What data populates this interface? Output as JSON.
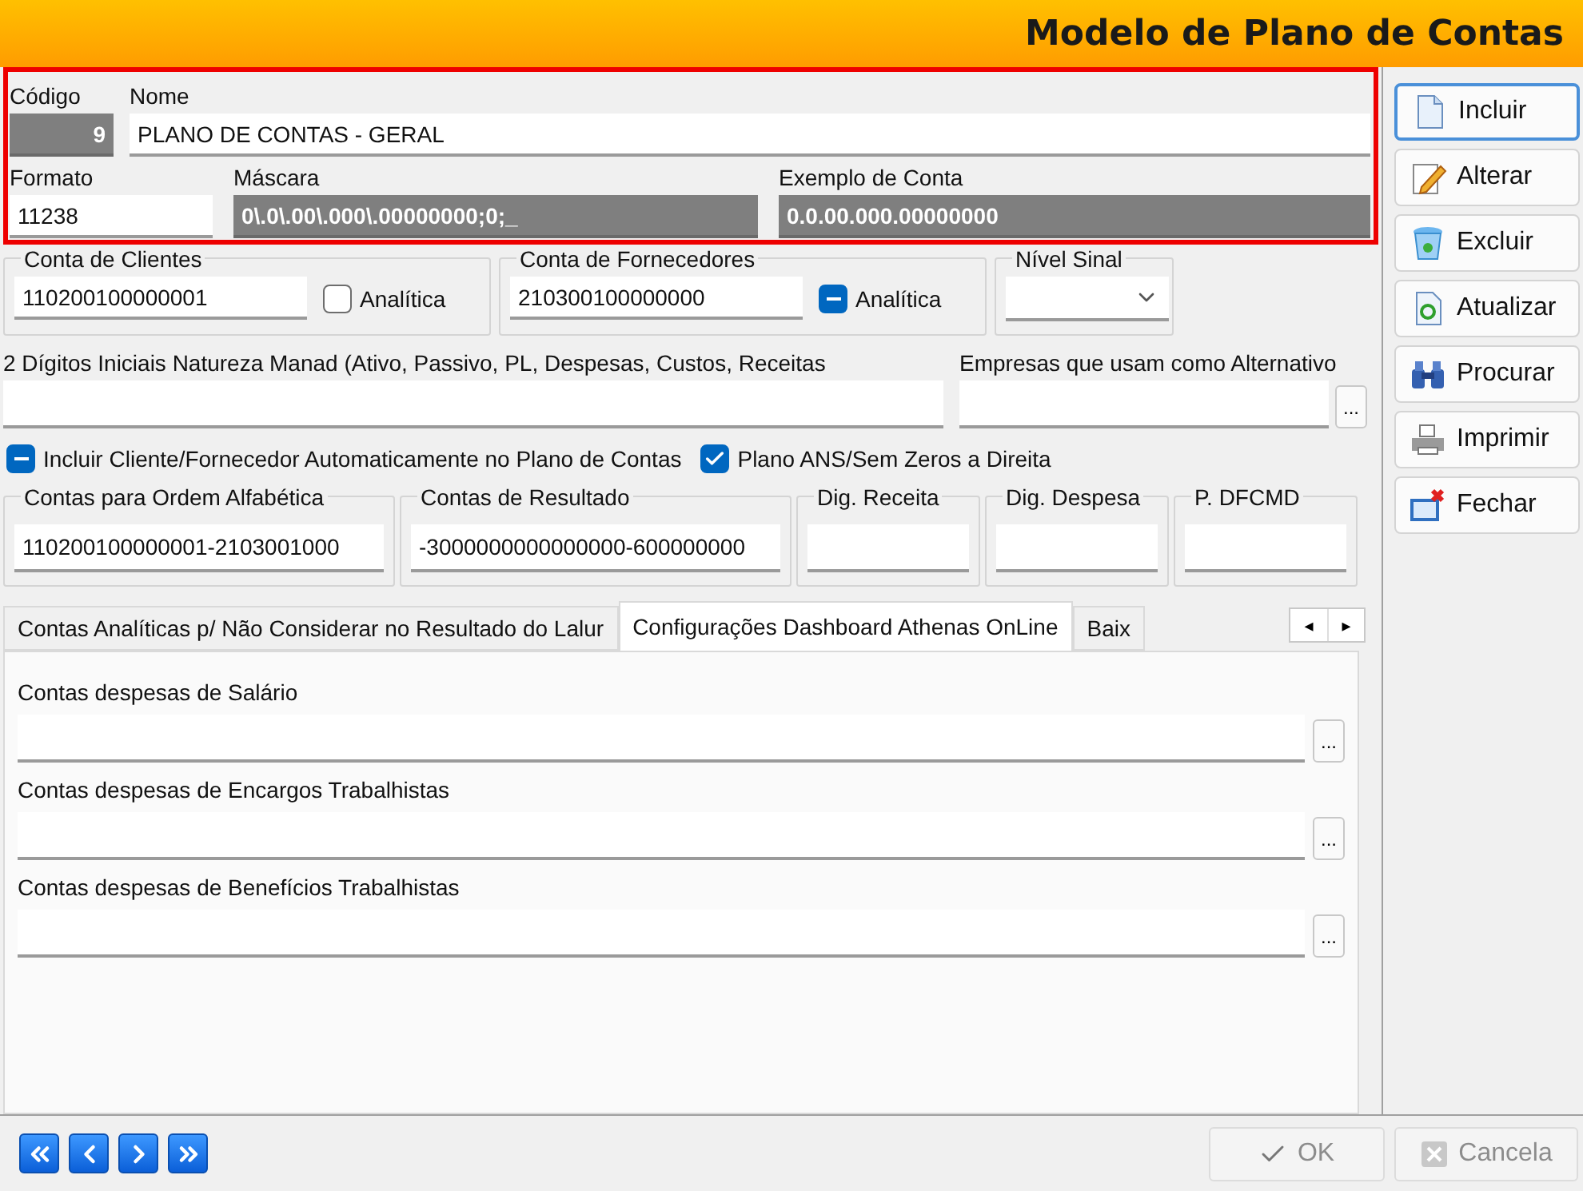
{
  "window": {
    "title": "Modelo de Plano de Contas"
  },
  "header": {
    "codigo": {
      "label": "Código",
      "value": "9"
    },
    "nome": {
      "label": "Nome",
      "value": "PLANO DE CONTAS - GERAL"
    },
    "formato": {
      "label": "Formato",
      "value": "11238"
    },
    "mascara": {
      "label": "Máscara",
      "value": "0\\.0\\.00\\.000\\.00000000;0;_"
    },
    "exemplo": {
      "label": "Exemplo de Conta",
      "value": "0.0.00.000.00000000"
    }
  },
  "contas": [
    {
      "title": "Conta de Clientes",
      "value": "110200100000001",
      "checkbox": {
        "label": "Analítica",
        "checked": false,
        "indeterminate": false
      }
    },
    {
      "title": "Conta de Fornecedores",
      "value": "210300100000000",
      "checkbox": {
        "label": "Analítica",
        "checked": true,
        "indeterminate": true
      }
    }
  ],
  "nivel_sinal": {
    "title": "Nível Sinal"
  },
  "natureza": {
    "label": "2 Dígitos Iniciais Natureza Manad (Ativo, Passivo, PL, Despesas, Custos, Receitas"
  },
  "empresas": {
    "label": "Empresas que usam como Alternativo",
    "button": "..."
  },
  "options": [
    {
      "label": "Incluir Cliente/Fornecedor Automaticamente no Plano de Contas",
      "checked": true,
      "indeterminate": true
    },
    {
      "label": "Plano ANS/Sem Zeros a Direita",
      "checked": true,
      "indeterminate": false
    }
  ],
  "groups": [
    {
      "title": "Contas para Ordem  Alfabética",
      "value": "110200100000001-2103001000"
    },
    {
      "title": "Contas de Resultado",
      "value": "-3000000000000000-600000000"
    },
    {
      "title": "Dig. Receita"
    },
    {
      "title": "Dig. Despesa"
    },
    {
      "title": "P. DFCMD"
    }
  ],
  "tabs": [
    {
      "label": "Contas Analíticas p/ Não Considerar no Resultado do Lalur",
      "selected": false
    },
    {
      "label": "Configurações Dashboard Athenas OnLine",
      "selected": true
    },
    {
      "label": "Baix",
      "selected": false
    }
  ],
  "tab_scroll": [
    "◂",
    "▸"
  ],
  "tab_fields": [
    {
      "label": "Contas despesas de Salário",
      "button": "..."
    },
    {
      "label": "Contas despesas de Encargos Trabalhistas",
      "button": "..."
    },
    {
      "label": "Contas despesas de Benefícios Trabalhistas",
      "button": "..."
    }
  ],
  "actions": [
    {
      "label": "Incluir",
      "kind": "new",
      "focused": true
    },
    {
      "label": "Alterar",
      "kind": "edit",
      "focused": false
    },
    {
      "label": "Excluir",
      "kind": "delete",
      "focused": false
    },
    {
      "label": "Atualizar",
      "kind": "refresh",
      "focused": false
    },
    {
      "label": "Procurar",
      "kind": "search",
      "focused": false
    },
    {
      "label": "Imprimir",
      "kind": "print",
      "focused": false
    },
    {
      "label": "Fechar",
      "kind": "close",
      "focused": false
    }
  ],
  "navigation": [
    {
      "kind": "first"
    },
    {
      "kind": "previous"
    },
    {
      "kind": "next"
    },
    {
      "kind": "last"
    }
  ],
  "footer": [
    {
      "label": "OK",
      "kind": "ok",
      "disabled": true
    },
    {
      "label": "Cancela",
      "kind": "cancel",
      "disabled": true
    }
  ]
}
